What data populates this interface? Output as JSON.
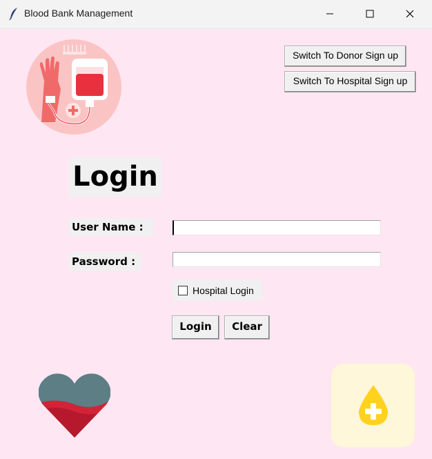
{
  "window": {
    "title": "Blood Bank Management",
    "controls": [
      "minimize-icon",
      "maximize-icon",
      "close-icon"
    ]
  },
  "header": {
    "logo_icon": "blood-donation-icon",
    "switch_donor_label": "Switch To Donor Sign up",
    "switch_hospital_label": "Switch To Hospital Sign up"
  },
  "form": {
    "title": "Login",
    "username_label": "User Name :",
    "username_value": "",
    "password_label": "Password :",
    "password_value": "",
    "hospital_checkbox_label": "Hospital Login",
    "hospital_checked": false,
    "login_label": "Login",
    "clear_label": "Clear"
  },
  "decorations": {
    "heart_icon": "blood-heart-icon",
    "drop_icon": "blood-drop-plus-icon"
  },
  "colors": {
    "background": "#ffe6f3",
    "blood_red": "#e8303f",
    "drop_yellow": "#ffd21f"
  }
}
